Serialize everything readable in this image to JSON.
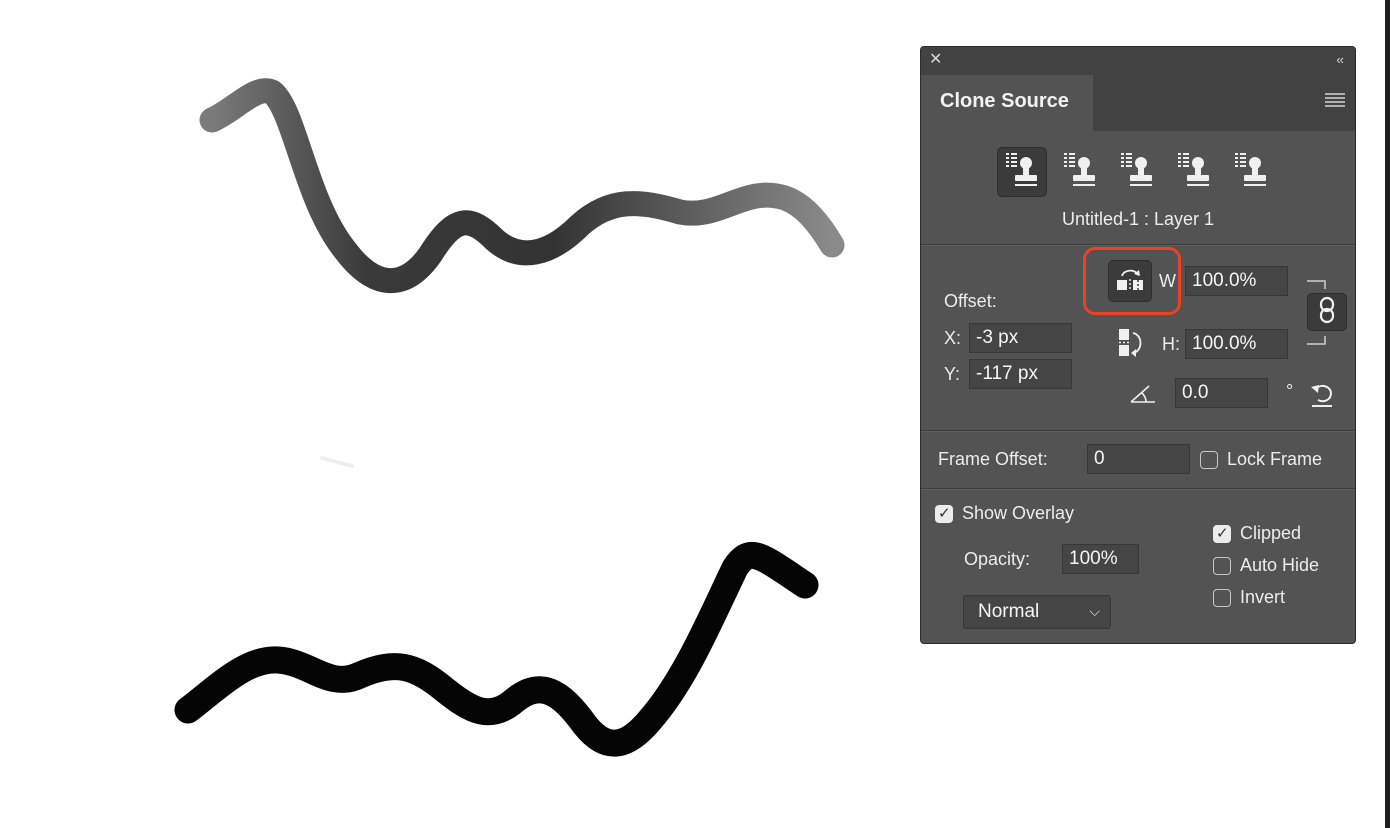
{
  "panel": {
    "title": "Clone Source",
    "source_label": "Untitled-1 : Layer 1",
    "clone_sources": [
      {
        "icon": "clone-stamp-icon",
        "active": true
      },
      {
        "icon": "clone-stamp-icon",
        "active": false
      },
      {
        "icon": "clone-stamp-icon",
        "active": false
      },
      {
        "icon": "clone-stamp-icon",
        "active": false
      },
      {
        "icon": "clone-stamp-icon",
        "active": false
      }
    ],
    "offset": {
      "label": "Offset:",
      "x_label": "X:",
      "x_value": "-3 px",
      "y_label": "Y:",
      "y_value": "-117 px"
    },
    "transform": {
      "w_label": "W",
      "w_value": "100.0%",
      "h_label": "H:",
      "h_value": "100.0%",
      "angle_value": "0.0",
      "degree_symbol": "°"
    },
    "frame": {
      "label": "Frame Offset:",
      "value": "0",
      "lock_label": "Lock Frame",
      "lock_checked": false
    },
    "overlay": {
      "show_label": "Show Overlay",
      "show_checked": true,
      "opacity_label": "Opacity:",
      "opacity_value": "100%",
      "blend_mode": "Normal",
      "clipped_label": "Clipped",
      "clipped_checked": true,
      "auto_hide_label": "Auto Hide",
      "auto_hide_checked": false,
      "invert_label": "Invert",
      "invert_checked": false
    }
  },
  "colors": {
    "panel_bg": "#535353",
    "highlight": "#ea4224",
    "overlay_stroke": "#6b6b6b",
    "brush_stroke": "#000000"
  }
}
